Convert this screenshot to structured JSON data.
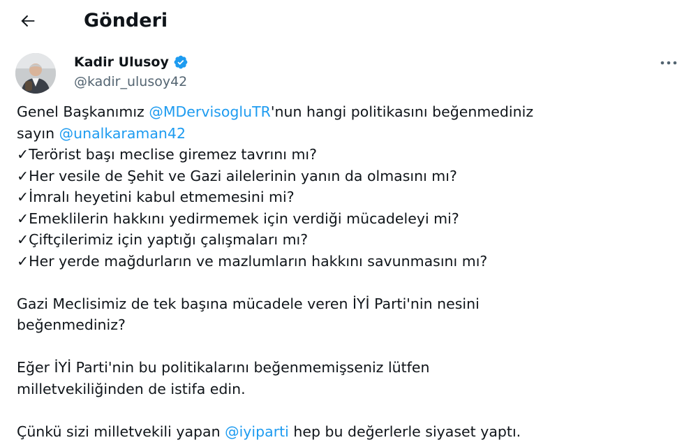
{
  "header": {
    "title": "Gönderi",
    "back_icon": "arrow-left-icon"
  },
  "author": {
    "name": "Kadir Ulusoy",
    "handle": "@kadir_ulusoy42",
    "verified_icon": "verified-badge-icon",
    "more_icon": "more-horizontal-icon"
  },
  "tweet": {
    "l1_a": "Genel Başkanımız ",
    "l1_mention": "@MDervisogluTR",
    "l1_b": "'nun hangi politikasını beğenmediniz",
    "l2_a": "sayın ",
    "l2_mention": "@unalkaraman42",
    "l3": "✓Terörist başı meclise giremez tavrını mı?",
    "l4": "✓Her vesile de Şehit ve Gazi ailelerinin yanın da olmasını mı?",
    "l5": "✓İmralı heyetini kabul etmemesini mi?",
    "l6": "✓Emeklilerin hakkını yedirmemek için verdiği mücadeleyi mi?",
    "l7": "✓Çiftçilerimiz için yaptığı çalışmaları mı?",
    "l8": "✓Her yerde mağdurların ve mazlumların hakkını savunmasını mı?",
    "p2_l1": "Gazi Meclisimiz de tek başına mücadele veren İYİ Parti'nin nesini",
    "p2_l2": "beğenmediniz?",
    "p3_l1": "Eğer İYİ Parti'nin bu politikalarını beğenmemişseniz lütfen",
    "p3_l2": "milletvekiliğinden de istifa edin.",
    "p4_a": "Çünkü sizi milletvekili yapan ",
    "p4_mention": "@iyiparti",
    "p4_b": " hep bu değerlerle siyaset yaptı."
  },
  "colors": {
    "mention": "#1d9bf0",
    "handle": "#536471",
    "text": "#0f1419",
    "verified": "#1d9bf0"
  }
}
